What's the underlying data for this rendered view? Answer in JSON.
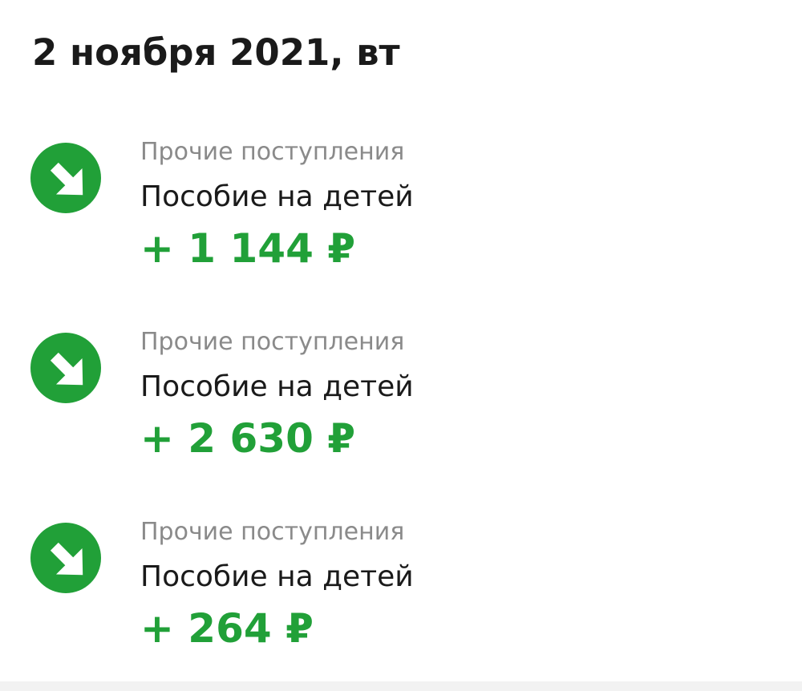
{
  "header": {
    "date": "2 ноября 2021, вт"
  },
  "colors": {
    "income_green": "#21a038",
    "category_gray": "#8a8a8a",
    "text_dark": "#1a1a1a"
  },
  "transactions": [
    {
      "icon": "incoming-arrow-icon",
      "category": "Прочие поступления",
      "title": "Пособие на детей",
      "amount": "+ 1 144 ₽"
    },
    {
      "icon": "incoming-arrow-icon",
      "category": "Прочие поступления",
      "title": "Пособие на детей",
      "amount": "+ 2 630 ₽"
    },
    {
      "icon": "incoming-arrow-icon",
      "category": "Прочие поступления",
      "title": "Пособие на детей",
      "amount": "+ 264 ₽"
    }
  ]
}
